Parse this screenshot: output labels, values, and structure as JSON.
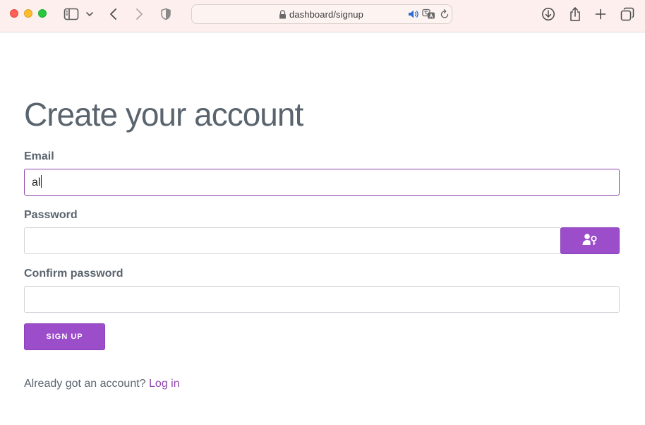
{
  "browser": {
    "url": "dashboard/signup",
    "icons": {
      "close": "close-window-button",
      "minimize": "minimize-window-button",
      "zoom": "zoom-window-button",
      "sidebar": "sidebar-icon",
      "back": "back-arrow-icon",
      "forward": "forward-arrow-icon",
      "privacy": "shield-icon",
      "downloads": "download-icon",
      "share": "share-icon",
      "new_tab": "plus-icon",
      "tabs": "tabs-overview-icon"
    },
    "colors": {
      "toolbar_bg": "#fcefed"
    }
  },
  "form": {
    "title": "Create your account",
    "email": {
      "label": "Email",
      "value": "al"
    },
    "password": {
      "label": "Password",
      "value": ""
    },
    "confirm_password": {
      "label": "Confirm password",
      "value": ""
    },
    "signup_label": "SIGN UP",
    "footer": {
      "prompt": "Already got an account?",
      "login_link": "Log in"
    },
    "colors": {
      "accent": "#9b4dca",
      "link": "#8e44ad",
      "text": "#5a646e"
    }
  }
}
